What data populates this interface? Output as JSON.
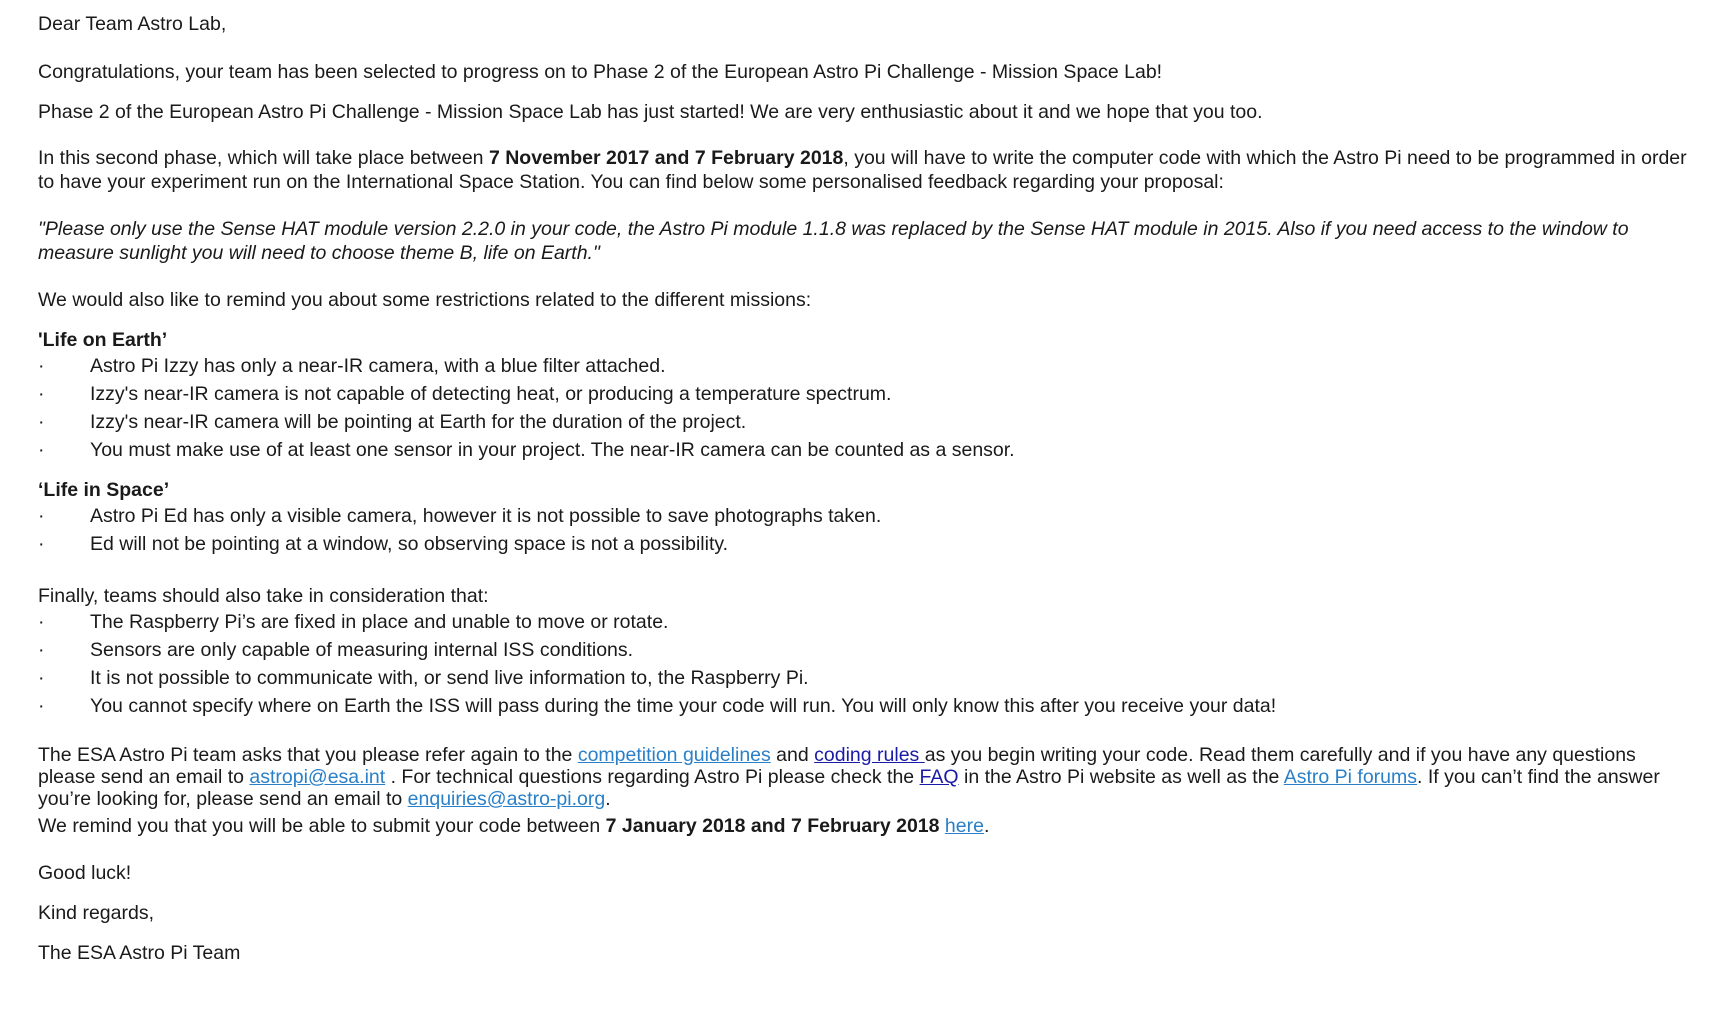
{
  "greeting": "Dear Team Astro Lab,",
  "congrats": "Congratulations, your team has been selected to progress on to Phase 2 of the European Astro Pi Challenge - Mission Space Lab!",
  "phase_started": "Phase 2 of the European Astro Pi Challenge - Mission Space Lab has just started! We are very enthusiastic about it and we hope that you too.",
  "second_phase": {
    "pre": "In this second phase, which will take place between ",
    "dates": "7 November 2017 and 7 February 2018",
    "post": ", you will have to write the computer code with which the Astro Pi need to be programmed in order to have your experiment run on the International Space Station. You can find below some personalised feedback regarding your proposal:"
  },
  "feedback_quote": "\"Please only use the Sense HAT module version 2.2.0 in your code, the Astro Pi module 1.1.8 was replaced by the Sense HAT module in 2015. Also if you need access to the window to measure sunlight you will need to choose theme B, life on Earth.\"",
  "remind_restrictions": "We would also like to remind you about some restrictions related to the different missions:",
  "bullet_char": "·",
  "life_on_earth": {
    "title": "'Life on Earth’",
    "items": [
      "Astro Pi Izzy has only a near-IR camera, with a blue filter attached.",
      "Izzy's near-IR camera is not capable of detecting heat, or producing a temperature spectrum.",
      "Izzy's near-IR camera will be pointing at Earth for the duration of the project.",
      "You must make use of at least one sensor in your project. The near-IR camera can be counted as a sensor."
    ]
  },
  "life_in_space": {
    "title": "‘Life in Space’",
    "items": [
      "Astro Pi Ed has only a visible camera, however it is not possible to save photographs taken.",
      "Ed will not be pointing at a window, so observing space is not a possibility."
    ]
  },
  "finally": {
    "intro": "Finally, teams should also take in consideration that:",
    "items": [
      "The Raspberry Pi’s are fixed in place and unable to move or rotate.",
      "Sensors are only capable of measuring internal ISS conditions.",
      "It is not possible to communicate with, or send live information to, the Raspberry Pi.",
      "You cannot specify where on Earth the ISS will pass during the time your code will run. You will only know this after you receive your data!"
    ]
  },
  "guidelines": {
    "t1": "The ESA Astro Pi team asks that you please refer again to the ",
    "link_guidelines": "competition guidelines",
    "t2": " and ",
    "link_coding_rules": "coding rules ",
    "t3": "as you begin writing your code. Read them carefully and if you have any questions please send an email to ",
    "link_email_esa": "astropi@esa.int",
    "t4": " . For technical questions regarding Astro Pi please check the ",
    "link_faq": "FAQ",
    "t5": " in the Astro Pi website as well as the ",
    "link_forums": "Astro Pi forums",
    "t6": ". If you can’t find the answer you’re looking for, please send an email to ",
    "link_enquiries": "enquiries@astro-pi.org",
    "t7": "."
  },
  "submit": {
    "pre": "We remind you that you will be able to submit your code between ",
    "dates": "7 January 2018 and 7 February 2018",
    "space": " ",
    "link_here": "here",
    "post": "."
  },
  "good_luck": "Good luck!",
  "kind_regards": "Kind regards,",
  "signature": "The ESA Astro Pi Team",
  "colors": {
    "link": "#2a80c8",
    "link_dark": "#1a1aa8",
    "text": "#1a1a1a"
  }
}
